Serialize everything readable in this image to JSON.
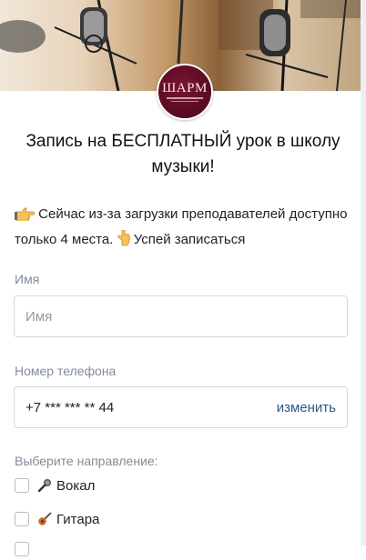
{
  "logo": {
    "text": "ШАРМ"
  },
  "title": "Запись на БЕСПЛАТНЫЙ урок в школу музыки!",
  "notice": {
    "icon_before": "pointing-right-hand-icon",
    "text_main": "Сейчас из-за загрузки преподавателей доступно только 4 места.",
    "icon_middle": "pointing-down-hand-icon",
    "text_end": "Успей записаться"
  },
  "form": {
    "name": {
      "label": "Имя",
      "placeholder": "Имя",
      "value": ""
    },
    "phone": {
      "label": "Номер телефона",
      "value": "+7 *** *** ** 44",
      "change_label": "изменить"
    },
    "direction": {
      "label": "Выберите направление:",
      "options": [
        {
          "label": "Вокал",
          "icon": "microphone-icon",
          "checked": false
        },
        {
          "label": "Гитара",
          "icon": "guitar-icon",
          "checked": false
        }
      ]
    }
  },
  "colors": {
    "link": "#2a5885",
    "label": "#818c99",
    "border": "#d3d9de",
    "logo_bg": "#5a0c22"
  }
}
